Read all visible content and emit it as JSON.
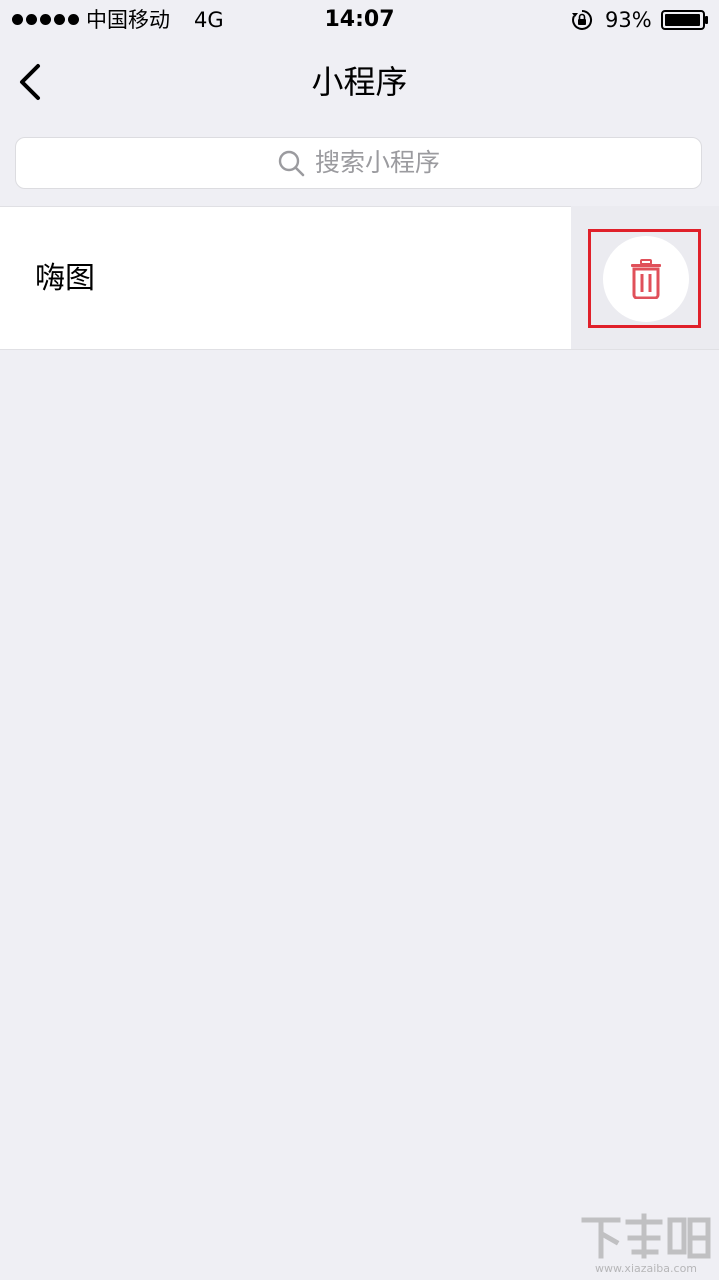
{
  "status_bar": {
    "carrier": "中国移动",
    "network": "4G",
    "time": "14:07",
    "battery_percent": "93%",
    "icons": [
      "signal-dots-icon",
      "orientation-lock-icon",
      "battery-icon"
    ]
  },
  "nav": {
    "title": "小程序",
    "back_icon": "chevron-left-icon"
  },
  "search": {
    "placeholder": "搜索小程序",
    "icon": "search-icon"
  },
  "list": {
    "items": [
      {
        "label": "嗨图",
        "action_icon": "trash-icon"
      }
    ]
  },
  "watermark": {
    "url": "www.xiazaiba.com"
  },
  "colors": {
    "background": "#efeff4",
    "delete_accent": "#e0505a",
    "highlight": "#e0202a"
  }
}
